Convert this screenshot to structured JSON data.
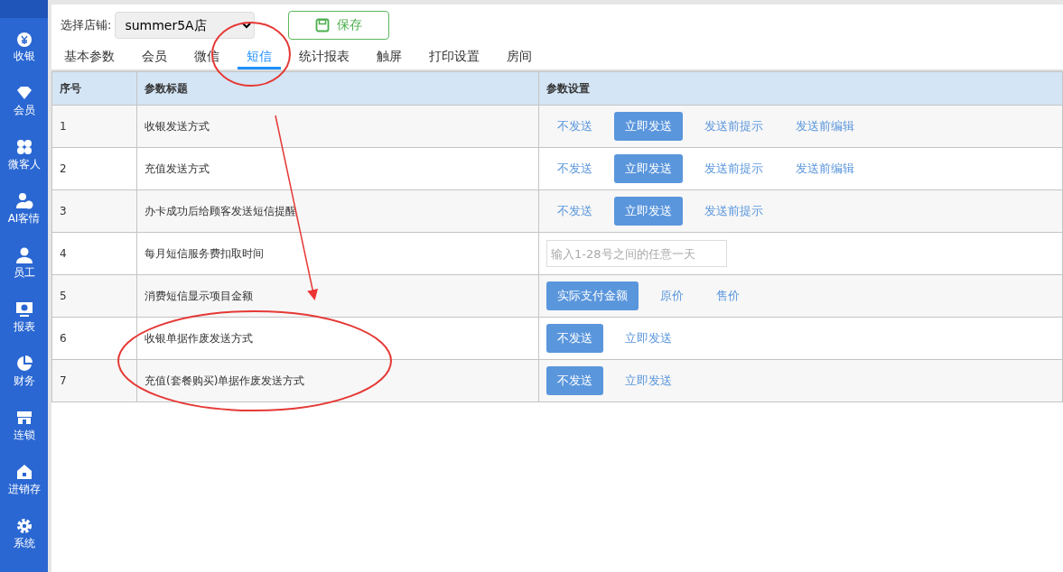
{
  "sidebar": {
    "items": [
      {
        "label": "收银"
      },
      {
        "label": "会员"
      },
      {
        "label": "微客人"
      },
      {
        "label": "AI客情"
      },
      {
        "label": "员工"
      },
      {
        "label": "报表"
      },
      {
        "label": "财务"
      },
      {
        "label": "连锁"
      },
      {
        "label": "进销存"
      },
      {
        "label": "系统"
      }
    ]
  },
  "store_select": {
    "label": "选择店铺:",
    "value": "summer5A店"
  },
  "save_button": "保存",
  "tabs": [
    {
      "label": "基本参数",
      "selected": false
    },
    {
      "label": "会员",
      "selected": false
    },
    {
      "label": "微信",
      "selected": false
    },
    {
      "label": "短信",
      "selected": true
    },
    {
      "label": "统计报表",
      "selected": false
    },
    {
      "label": "触屏",
      "selected": false
    },
    {
      "label": "打印设置",
      "selected": false
    },
    {
      "label": "房间",
      "selected": false
    }
  ],
  "table": {
    "columns": [
      "序号",
      "参数标题",
      "参数设置"
    ],
    "rows": [
      {
        "no": "1",
        "title": "收银发送方式",
        "kind": "options",
        "options": [
          {
            "label": "不发送",
            "selected": false
          },
          {
            "label": "立即发送",
            "selected": true
          },
          {
            "label": "发送前提示",
            "selected": false
          },
          {
            "label": "发送前编辑",
            "selected": false
          }
        ]
      },
      {
        "no": "2",
        "title": "充值发送方式",
        "kind": "options",
        "options": [
          {
            "label": "不发送",
            "selected": false
          },
          {
            "label": "立即发送",
            "selected": true
          },
          {
            "label": "发送前提示",
            "selected": false
          },
          {
            "label": "发送前编辑",
            "selected": false
          }
        ]
      },
      {
        "no": "3",
        "title": "办卡成功后给顾客发送短信提醒",
        "kind": "options",
        "options": [
          {
            "label": "不发送",
            "selected": false
          },
          {
            "label": "立即发送",
            "selected": true
          },
          {
            "label": "发送前提示",
            "selected": false
          }
        ]
      },
      {
        "no": "4",
        "title": "每月短信服务费扣取时间",
        "kind": "input",
        "placeholder": "输入1-28号之间的任意一天"
      },
      {
        "no": "5",
        "title": "消费短信显示项目金额",
        "kind": "options",
        "options": [
          {
            "label": "实际支付金额",
            "selected": true
          },
          {
            "label": "原价",
            "selected": false
          },
          {
            "label": "售价",
            "selected": false
          }
        ]
      },
      {
        "no": "6",
        "title": "收银单据作废发送方式",
        "kind": "options",
        "options": [
          {
            "label": "不发送",
            "selected": true
          },
          {
            "label": "立即发送",
            "selected": false
          }
        ]
      },
      {
        "no": "7",
        "title": "充值(套餐购买)单据作废发送方式",
        "kind": "options",
        "options": [
          {
            "label": "不发送",
            "selected": true
          },
          {
            "label": "立即发送",
            "selected": false
          }
        ]
      }
    ]
  },
  "annotations": [
    {
      "kind": "circle"
    },
    {
      "kind": "arrow"
    },
    {
      "kind": "circle"
    }
  ]
}
